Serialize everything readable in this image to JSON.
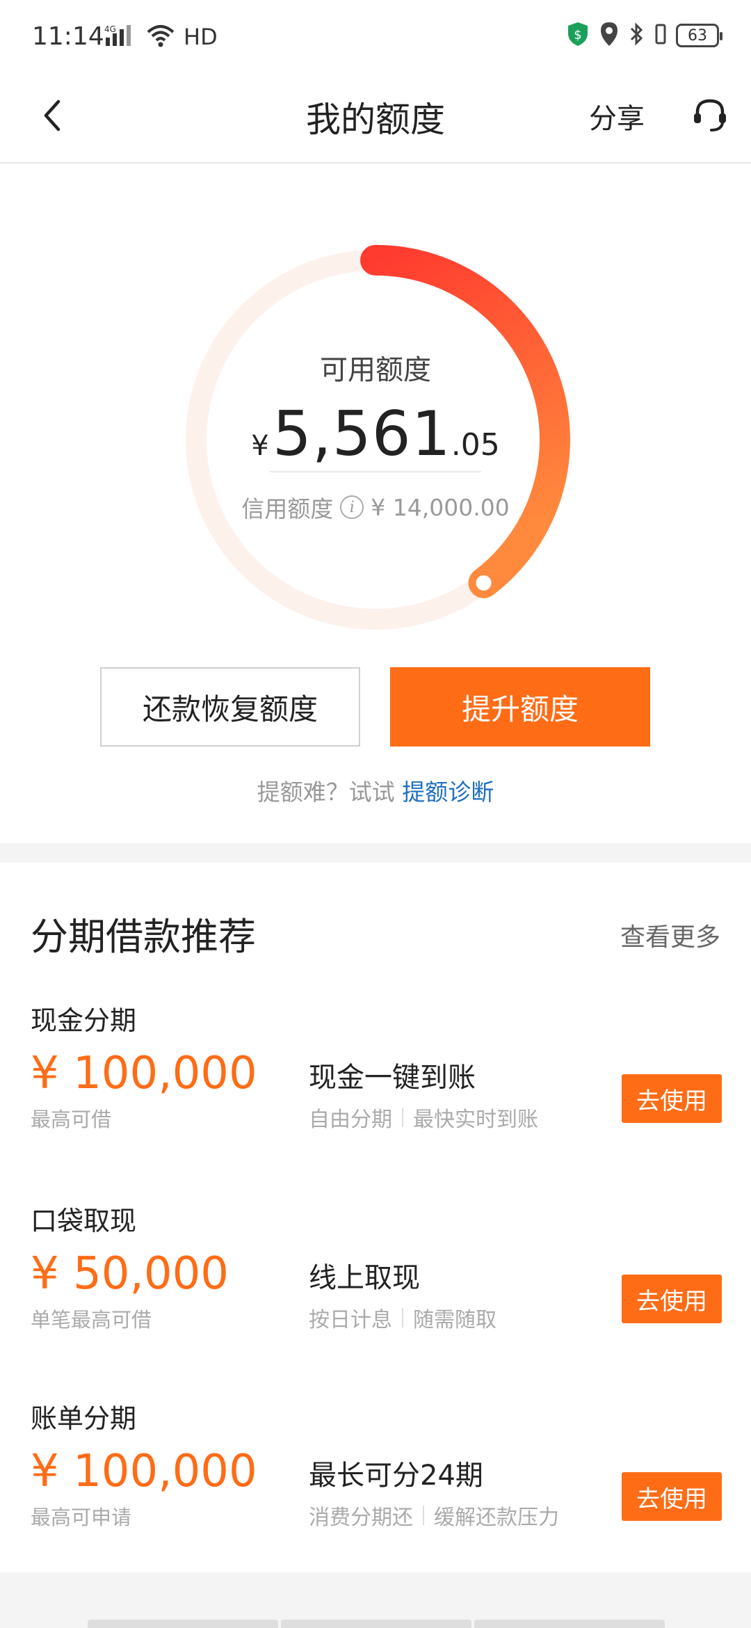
{
  "status_bar": {
    "time": "11:14",
    "network": "4G",
    "hd": "HD",
    "battery": "63"
  },
  "nav": {
    "title": "我的额度",
    "share": "分享"
  },
  "quota": {
    "available_label": "可用额度",
    "currency": "¥",
    "available_int": "5,561",
    "available_dec": ".05",
    "credit_label": "信用额度",
    "credit_amount": "¥ 14,000.00",
    "available_ratio": 0.397,
    "restore_button": "还款恢复额度",
    "raise_button": "提升额度",
    "hint_text": "提额难？试试",
    "hint_link": "提额诊断"
  },
  "recommend": {
    "title": "分期借款推荐",
    "more": "查看更多",
    "items": [
      {
        "name": "现金分期",
        "amount": "¥ 100,000",
        "sub": "最高可借",
        "feature": "现金一键到账",
        "tag1": "自由分期",
        "tag2": "最快实时到账",
        "button": "去使用"
      },
      {
        "name": "口袋取现",
        "amount": "¥ 50,000",
        "sub": "单笔最高可借",
        "feature": "线上取现",
        "tag1": "按日计息",
        "tag2": "随需随取",
        "button": "去使用"
      },
      {
        "name": "账单分期",
        "amount": "¥ 100,000",
        "sub": "最高可申请",
        "feature": "最长可分24期",
        "tag1": "消费分期还",
        "tag2": "缓解还款压力",
        "button": "去使用"
      }
    ]
  },
  "colors": {
    "accent": "#ff6c16",
    "ring_start": "#ff3b2f",
    "ring_end": "#ff8a3d",
    "ring_track": "#fdf1ec",
    "link": "#1f6fbf"
  }
}
